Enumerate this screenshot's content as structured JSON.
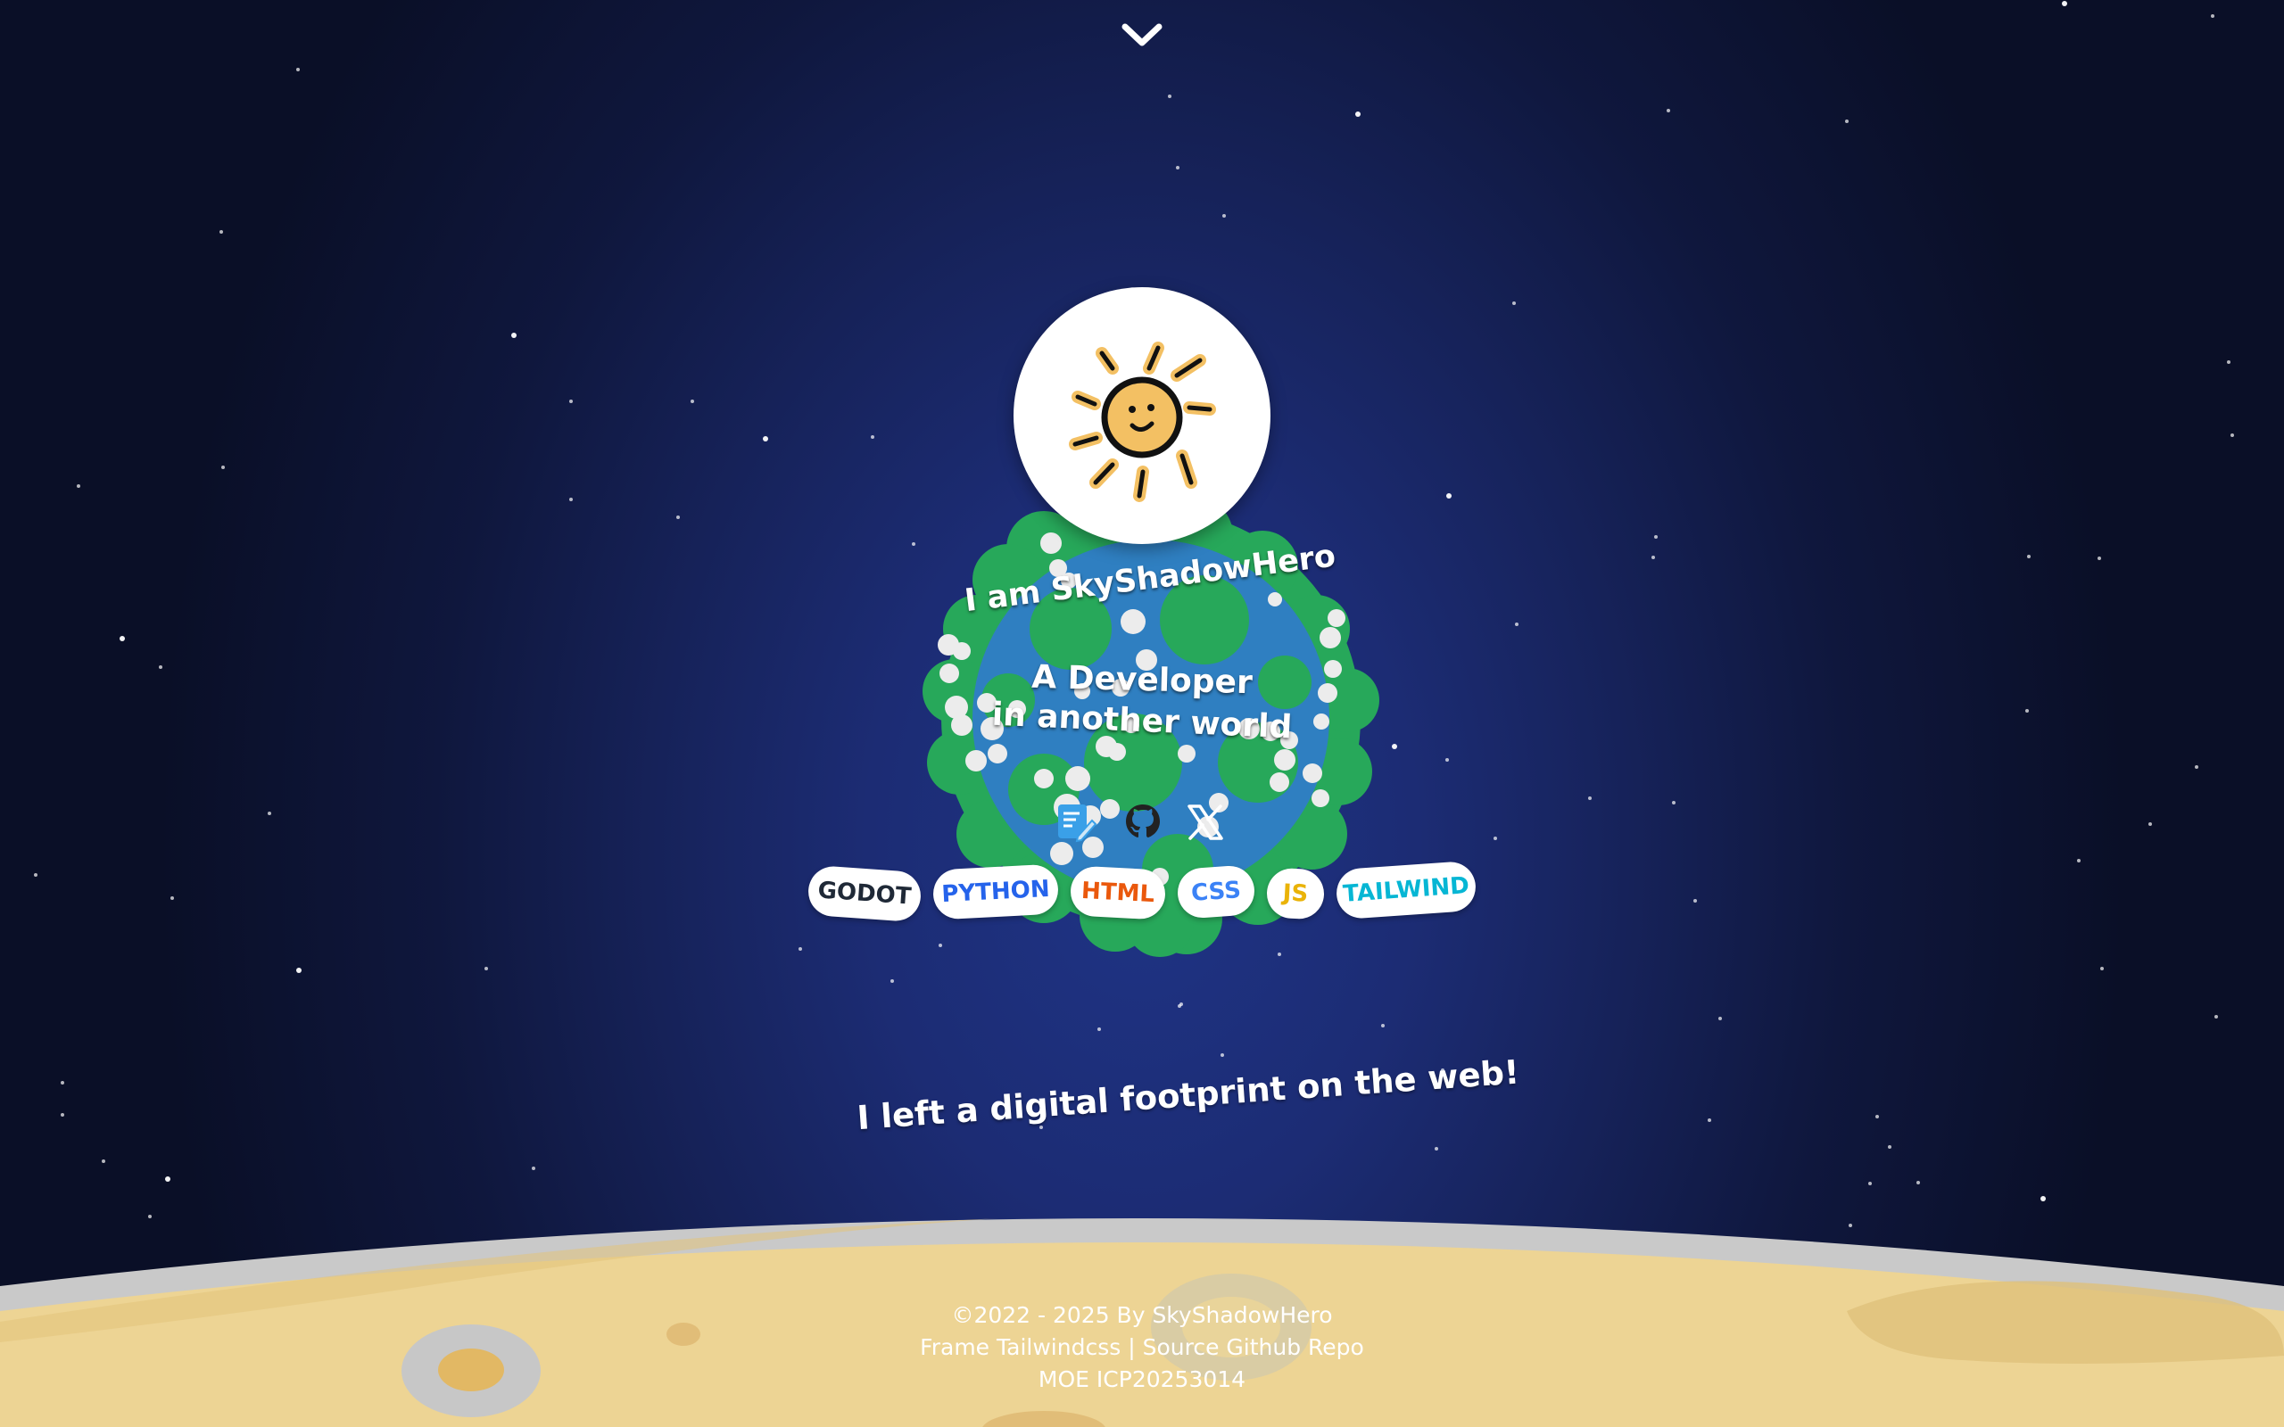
{
  "intro": {
    "name": "I am SkyShadowHero",
    "line1": "A Developer",
    "line2": "in another world"
  },
  "social": {
    "blog_icon": "blog-edit-icon",
    "github_icon": "github-icon",
    "x_icon": "x-icon"
  },
  "tags": [
    {
      "label": "GODOT",
      "color": "#1f2937"
    },
    {
      "label": "PYTHON",
      "color": "#2563eb"
    },
    {
      "label": "HTML",
      "color": "#ea580c"
    },
    {
      "label": "CSS",
      "color": "#3b82f6"
    },
    {
      "label": "JS",
      "color": "#eab308"
    },
    {
      "label": "TAILWIND",
      "color": "#06b6d4"
    }
  ],
  "tagline": "I left a digital footprint on the web!",
  "footer": {
    "copyright": "©2022 - 2025 By SkyShadowHero",
    "frame_prefix": "Frame",
    "frame_name": "Tailwindcss",
    "separator": "|",
    "source_label": "Source Github Repo",
    "icp": "MOE ICP20253014"
  },
  "colors": {
    "space_center": "#1f3486",
    "space_edge": "#0a0f27",
    "ocean": "#2f7fc1",
    "land": "#27a85a",
    "moon_surface": "#edd494",
    "moon_rim": "#c8c8c8",
    "sun": "#f3c063"
  }
}
